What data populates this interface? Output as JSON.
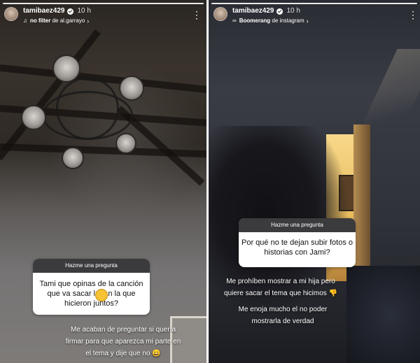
{
  "stories": [
    {
      "username": "tamibaez429",
      "time": "10 h",
      "subtitle_icon": "music-note-icon",
      "subtitle_bold": "no filter",
      "subtitle_rest": "de al.garrayo",
      "question_header": "Hazme una pregunta",
      "question_lines": [
        "Tami que opinas de la canción",
        "que va sacar logan la que",
        "hicieron juntos?"
      ],
      "caption_lines": [
        "Me acaban de preguntar si quería",
        "firmar para que aparezca mi parte en",
        "el tema y dije que no 😄"
      ]
    },
    {
      "username": "tamibaez429",
      "time": "10 h",
      "subtitle_icon": "boomerang-icon",
      "subtitle_bold": "Boomerang",
      "subtitle_rest": "de instagram",
      "question_header": "Hazme una pregunta",
      "question_lines": [
        "Por qué no te dejan subir fotos o",
        "historias con Jami?"
      ],
      "caption_lines": [
        "Me prohíben mostrar a mi hija pero",
        "quiere sacar el tema que hicimos 👎"
      ],
      "caption2_lines": [
        "Me enoja mucho el no poder",
        "mostrarla de verdad"
      ]
    }
  ],
  "colors": {
    "sticker_header": "#3b3b3d",
    "sticker_body": "#ffffff",
    "text": "#ffffff"
  }
}
